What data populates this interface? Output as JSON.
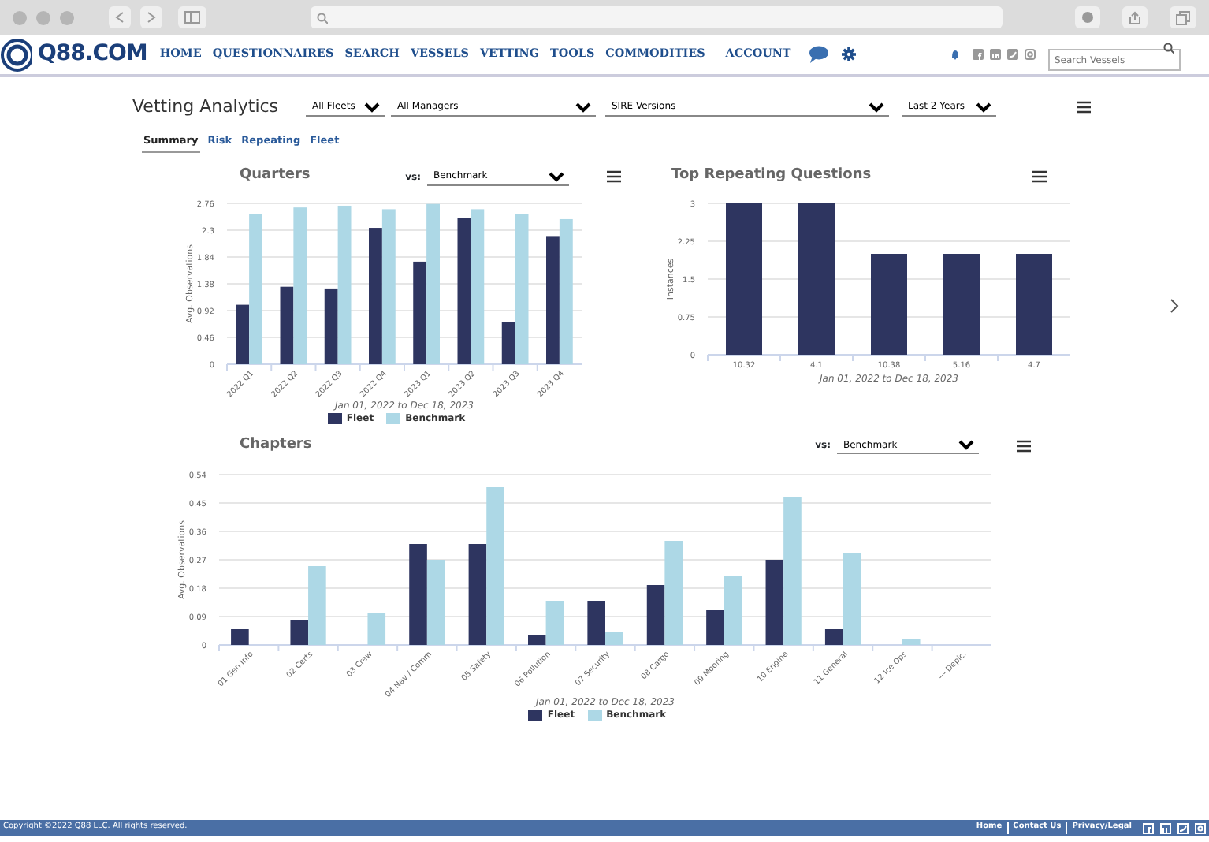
{
  "navbar": {
    "logo": "Q88.COM",
    "items": [
      "HOME",
      "QUESTIONNAIRES",
      "SEARCH",
      "VESSELS",
      "VETTING",
      "TOOLS",
      "COMMODITIES",
      "ACCOUNT"
    ],
    "search": {
      "placeholder": "Search Vessels"
    }
  },
  "page": {
    "title": "Vetting Analytics",
    "filters": [
      "All Fleets",
      "All Managers",
      "SIRE Versions",
      "Last 2 Years"
    ],
    "tabs": [
      {
        "label": "Summary",
        "selected": true
      },
      {
        "label": "Risk",
        "selected": false
      },
      {
        "label": "Repeating",
        "selected": false
      },
      {
        "label": "Fleet",
        "selected": false
      }
    ]
  },
  "charts": [
    {
      "vs_label": "vs:",
      "vs": "Benchmark",
      "chart_data": {
        "type": "bar",
        "title": "Quarters",
        "xlabel": "Jan 01, 2022 to Dec 18, 2023",
        "ylabel": "Avg. Observations",
        "categories": [
          "2022 Q1",
          "2022 Q2",
          "2022 Q3",
          "2022 Q4",
          "2023 Q1",
          "2023 Q2",
          "2023 Q3",
          "2023 Q4"
        ],
        "series": [
          {
            "name": "Fleet",
            "color": "#2e3560",
            "values": [
              1.02,
              1.33,
              1.3,
              2.34,
              1.76,
              2.51,
              0.73,
              2.2
            ]
          },
          {
            "name": "Benchmark",
            "color": "#add8e6",
            "values": [
              2.58,
              2.69,
              2.72,
              2.66,
              2.75,
              2.66,
              2.58,
              2.49
            ]
          }
        ],
        "yticks": [
          0,
          0.46,
          0.92,
          1.38,
          1.84,
          2.3,
          2.76
        ],
        "ylim": [
          0,
          2.76
        ],
        "grid": true
      }
    },
    {
      "chart_data": {
        "type": "bar",
        "title": "Top Repeating Questions",
        "xlabel": "Jan 01, 2022 to Dec 18, 2023",
        "ylabel": "Instances",
        "categories": [
          "10.32",
          "4.1",
          "10.38",
          "5.16",
          "4.7"
        ],
        "series": [
          {
            "color": "#2e3560",
            "values": [
              3,
              3,
              2,
              2,
              2
            ]
          }
        ],
        "grid": true,
        "yticks": [
          0,
          0.75,
          1.5,
          2.25,
          3
        ],
        "ylim": [
          0,
          3
        ]
      }
    },
    {
      "vs_label": "vs:",
      "vs": "Benchmark",
      "chart_data": {
        "type": "bar",
        "title": "Chapters",
        "xlabel": "Jan 01, 2022 to Dec 18, 2023",
        "ylabel": "Avg. Observations",
        "categories": [
          "01 Gen Info",
          "02 Certs",
          "03 Crew",
          "04 Nav / Comm",
          "05 Safety",
          "06 Pollution",
          "07 Security",
          "08 Cargo",
          "09 Mooring",
          "10 Engine",
          "11 General",
          "12 Ice Ops",
          "--- Depic."
        ],
        "series": [
          {
            "name": "Fleet",
            "color": "#2e3560",
            "values": [
              0.05,
              0.08,
              0,
              0.32,
              0.32,
              0.03,
              0.14,
              0.19,
              0.11,
              0.27,
              0.05,
              0,
              0
            ]
          },
          {
            "name": "Benchmark",
            "color": "#add8e6",
            "values": [
              0,
              0.25,
              0.1,
              0.27,
              0.5,
              0.14,
              0.04,
              0.33,
              0.22,
              0.47,
              0.29,
              0.02,
              0
            ]
          }
        ],
        "yticks": [
          0,
          0.09,
          0.18,
          0.27,
          0.36,
          0.45,
          0.54
        ],
        "ylim": [
          0,
          0.54
        ],
        "grid": true
      }
    }
  ],
  "footer": {
    "copyright": "Copyright ©2022 Q88 LLC. All rights reserved.",
    "links": [
      "Home",
      "Contact Us",
      "Privacy/Legal"
    ]
  }
}
